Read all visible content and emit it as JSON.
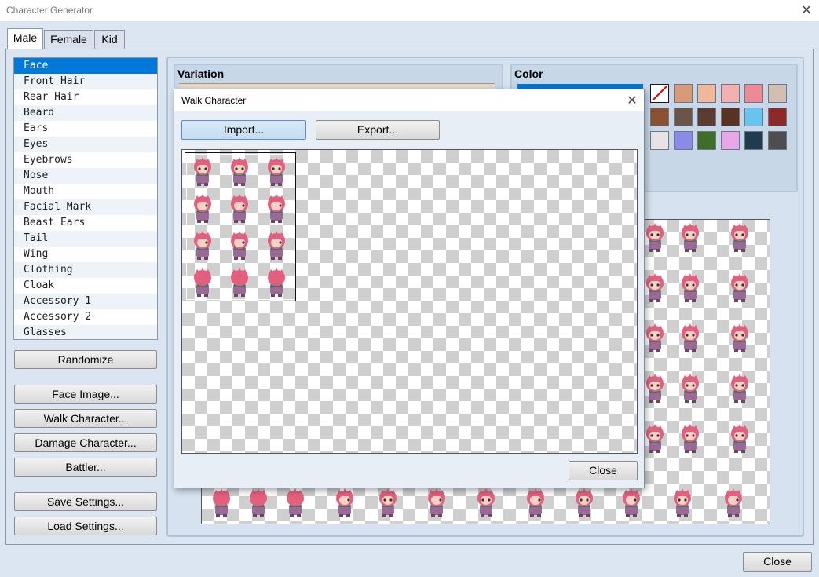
{
  "window": {
    "title": "Character Generator",
    "close_glyph": "✕"
  },
  "tabs": [
    {
      "label": "Male",
      "active": true
    },
    {
      "label": "Female"
    },
    {
      "label": "Kid"
    }
  ],
  "parts": [
    "Face",
    "Front Hair",
    "Rear Hair",
    "Beard",
    "Ears",
    "Eyes",
    "Eyebrows",
    "Nose",
    "Mouth",
    "Facial Mark",
    "Beast Ears",
    "Tail",
    "Wing",
    "Clothing",
    "Cloak",
    "Accessory 1",
    "Accessory 2",
    "Glasses"
  ],
  "buttons": {
    "randomize": "Randomize",
    "face_image": "Face Image...",
    "walk_character": "Walk Character...",
    "damage_character": "Damage Character...",
    "battler": "Battler...",
    "save_settings": "Save Settings...",
    "load_settings": "Load Settings...",
    "close": "Close"
  },
  "variation": {
    "title": "Variation"
  },
  "color": {
    "title": "Color",
    "swatches": [
      "#d99a7a",
      "#f0b89a",
      "#f2b0b0",
      "#ee8a96",
      "#d2bfb2",
      "#8c5032",
      "#6b5448",
      "#5c3c30",
      "#5a3222",
      "#66c4ee",
      "#8c2a2a",
      "#e8e2e4",
      "#8a8ae8",
      "#3e6e2a",
      "#e8a8e8",
      "#1f3c4e",
      "#4e4e4e"
    ]
  },
  "dialog": {
    "title": "Walk Character",
    "import_label": "Import...",
    "export_label": "Export...",
    "close_label": "Close"
  },
  "colors": {
    "selection": "#0078d7",
    "hair": "#e2607e",
    "armor": "#9a6a96",
    "scarf": "#3c7a6a"
  }
}
